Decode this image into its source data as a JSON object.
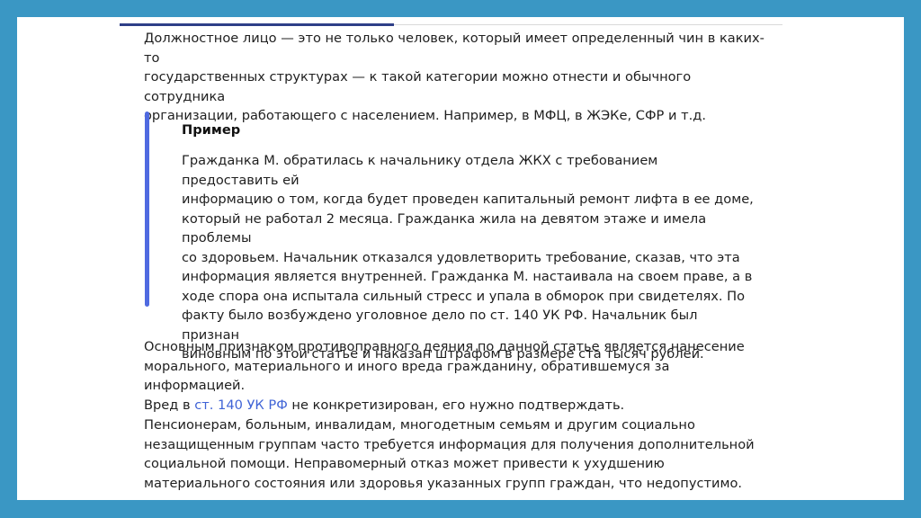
{
  "document": {
    "intro_lines": [
      "Должностное лицо — это не только человек, который имеет определенный чин в каких-то",
      "государственных структурах — к такой категории можно отнести и обычного сотрудника",
      "организации, работающего с населением. Например, в МФЦ, в ЖЭКе, СФР и т.д."
    ],
    "example": {
      "title": "Пример",
      "lines": [
        "Гражданка М. обратилась к начальнику отдела ЖКХ с требованием предоставить ей",
        "информацию о том, когда будет проведен капитальный ремонт лифта в ее доме,",
        "который не работал 2 месяца. Гражданка жила на девятом этаже и имела проблемы",
        "со здоровьем. Начальник отказался удовлетворить требование, сказав, что эта",
        "информация является внутренней. Гражданка М. настаивала на своем праве, а в",
        "ходе спора она испытала сильный стресс и упала в обморок при свидетелях. По",
        "факту было возбуждено уголовное дело по ст. 140 УК РФ. Начальник был признан",
        "виновным по этой статье и наказан штрафом в размере ста тысяч рублей."
      ]
    },
    "para2": {
      "line1": "Основным признаком противоправного деяния по данной статье является нанесение",
      "line2": "морального, материального и иного вреда гражданину, обратившемуся за информацией.",
      "line3_before": "Вред в ",
      "line3_link": "ст. 140 УК РФ",
      "line3_after": " не конкретизирован, его нужно подтверждать."
    },
    "para3_lines": [
      "Пенсионерам, больным, инвалидам, многодетным семьям и другим социально",
      "незащищенным группам часто требуется информация для получения дополнительной",
      "социальной помощи. Неправомерный отказ может привести к ухудшению",
      "материального состояния или здоровья указанных групп граждан, что недопустимо."
    ]
  },
  "colors": {
    "frame": "#3a97c4",
    "accent_rule": "#2e3f88",
    "quote_bar": "#4f6ae0",
    "link": "#3f63d6"
  }
}
